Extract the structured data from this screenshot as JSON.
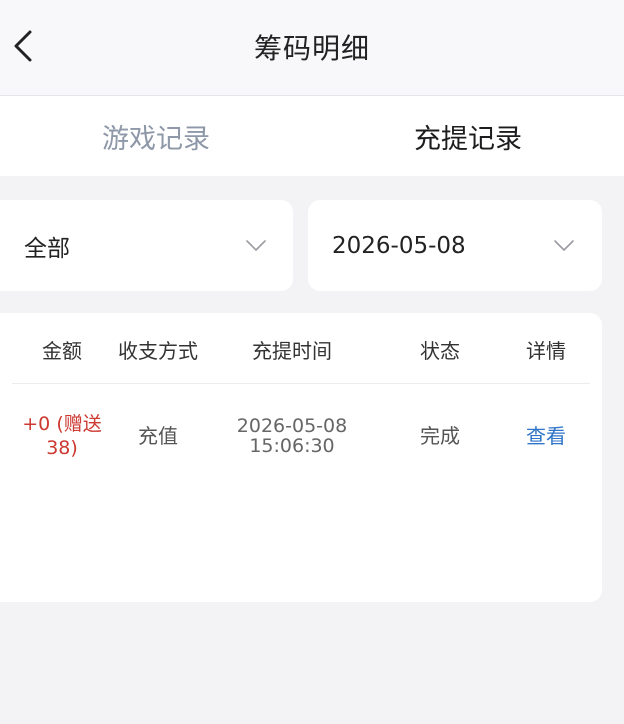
{
  "header": {
    "title": "筹码明细",
    "back_icon": "chevron-left-icon"
  },
  "tabs": [
    {
      "label": "游戏记录",
      "active": false
    },
    {
      "label": "充提记录",
      "active": true
    }
  ],
  "filters": {
    "type_value": "全部",
    "date_value": "2026-05-08",
    "dropdown_icon": "chevron-down-icon"
  },
  "table": {
    "columns": [
      "金额",
      "收支方式",
      "充提时间",
      "状态",
      "详情"
    ],
    "rows": [
      {
        "amount_line1": "+0 (赠送",
        "amount_line2": "38)",
        "method": "充值",
        "date": "2026-05-08",
        "time": "15:06:30",
        "status": "完成",
        "detail": "查看"
      }
    ]
  },
  "colors": {
    "amount": "#cc3a32",
    "link": "#2f75c9",
    "inactive_tab": "#8e98a8",
    "background": "#f3f3f5"
  }
}
